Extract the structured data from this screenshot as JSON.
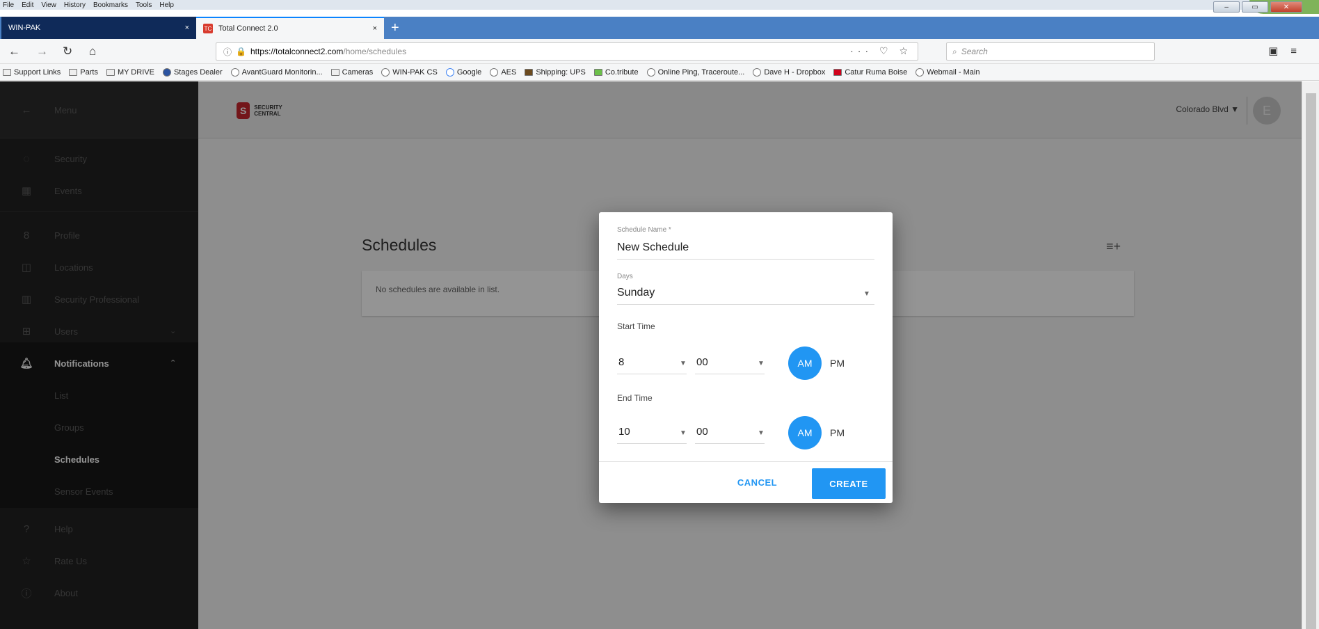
{
  "browser": {
    "menu": [
      "File",
      "Edit",
      "View",
      "History",
      "Bookmarks",
      "Tools",
      "Help"
    ],
    "tabs": [
      {
        "label": "WIN-PAK",
        "close": "×"
      },
      {
        "label": "Total Connect 2.0",
        "close": "×",
        "favicon": "tc"
      }
    ],
    "new_tab": "+",
    "url": {
      "host": "https://totalconnect2.com",
      "path": "/home/schedules"
    },
    "url_actions": "··· ♡ ☆",
    "search_placeholder": "Search",
    "bookmarks": [
      "Support Links",
      "Parts",
      "MY DRIVE",
      "Stages Dealer",
      "AvantGuard Monitorin...",
      "Cameras",
      "WIN-PAK CS",
      "Google",
      "AES",
      "Shipping: UPS",
      "Co.tribute",
      "Online Ping, Traceroute...",
      "Dave H - Dropbox",
      "Catur Ruma Boise",
      "Webmail - Main"
    ]
  },
  "sidebar": {
    "menu_label": "Menu",
    "items": [
      {
        "label": "Security",
        "icon": "shield-icon"
      },
      {
        "label": "Events",
        "icon": "calendar-icon"
      },
      {
        "label": "Profile",
        "icon": "person-icon"
      },
      {
        "label": "Locations",
        "icon": "location-icon"
      },
      {
        "label": "Security Professional",
        "icon": "building-icon"
      },
      {
        "label": "Users",
        "icon": "users-icon"
      },
      {
        "label": "Notifications",
        "icon": "bell-icon"
      },
      {
        "label": "Help",
        "icon": "help-icon"
      },
      {
        "label": "Rate Us",
        "icon": "star-icon"
      },
      {
        "label": "About",
        "icon": "info-icon"
      }
    ],
    "sub_items": [
      "List",
      "Groups",
      "Schedules",
      "Sensor Events"
    ]
  },
  "header": {
    "logo_text": "SECURITY CENTRAL",
    "location": "Colorado Blvd",
    "avatar_initial": "E"
  },
  "main": {
    "title": "Schedules",
    "empty_text": "No schedules are available in list."
  },
  "dialog": {
    "name_label": "Schedule Name *",
    "name_value": "New Schedule",
    "days_label": "Days",
    "days_value": "Sunday",
    "start_label": "Start Time",
    "start_hour": "8",
    "start_min": "00",
    "end_label": "End Time",
    "end_hour": "10",
    "end_min": "00",
    "am": "AM",
    "pm": "PM",
    "cancel": "CANCEL",
    "create": "CREATE",
    "accent_color": "#2196f3"
  }
}
